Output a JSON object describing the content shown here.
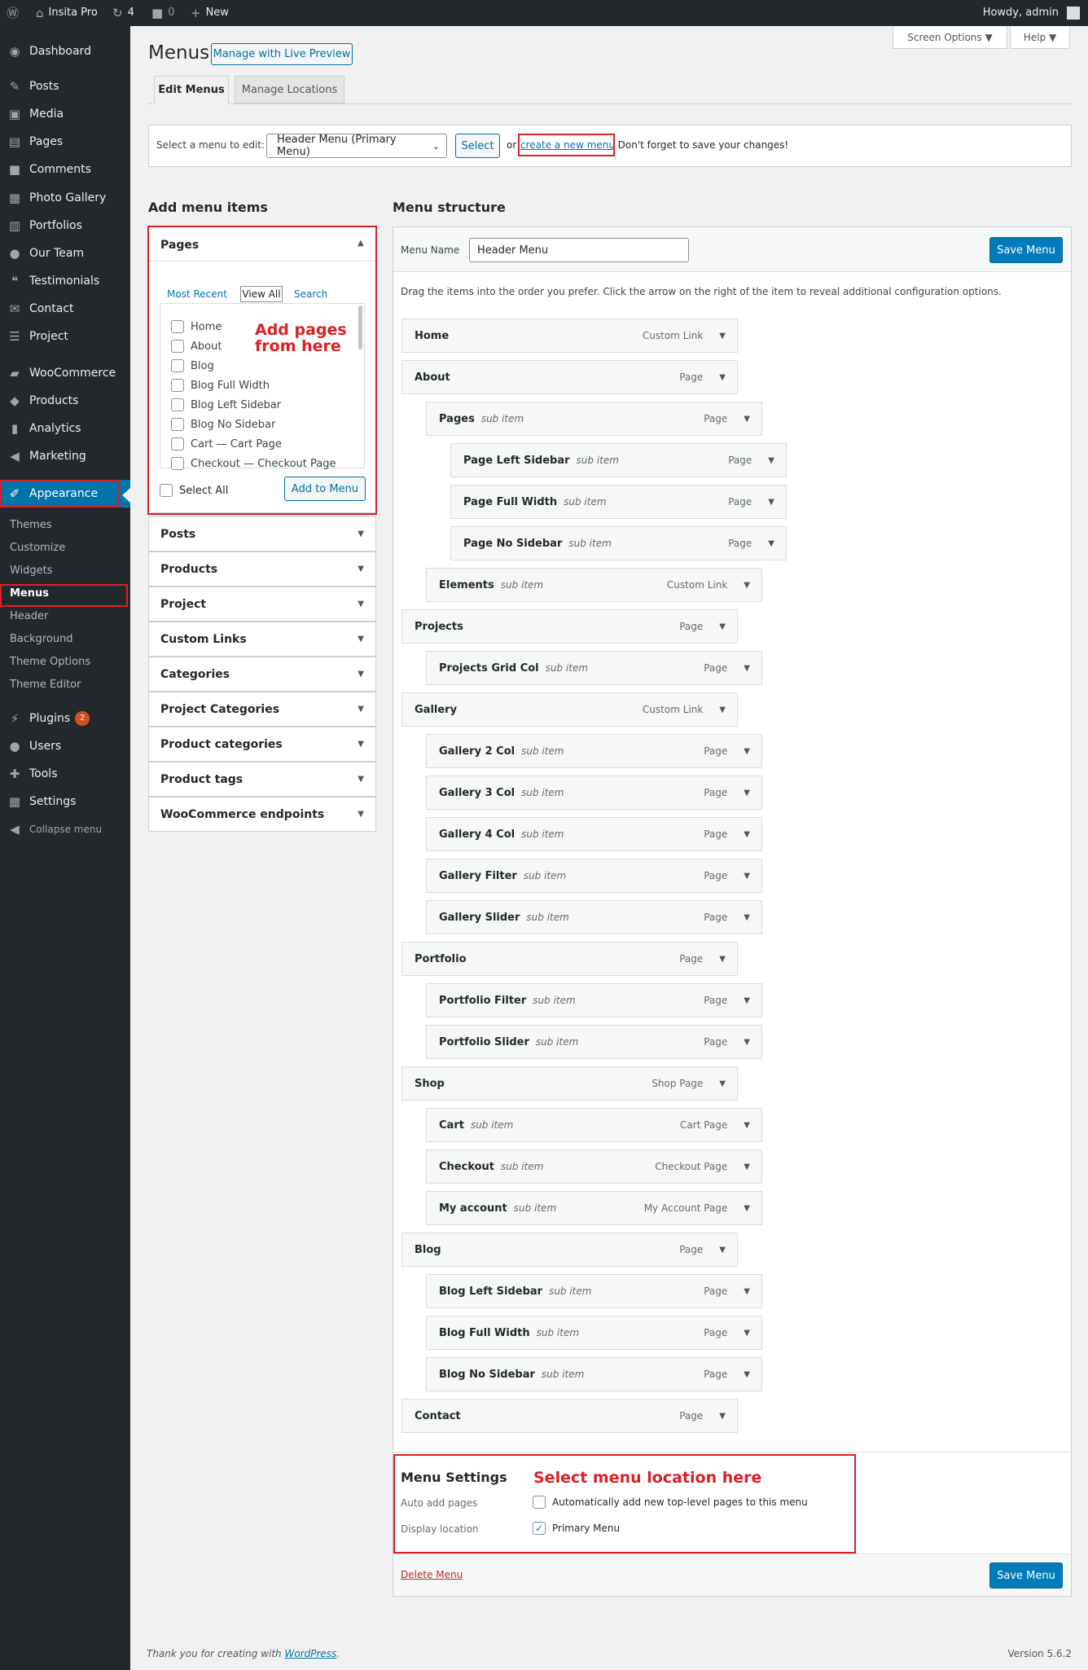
{
  "adminbar": {
    "site": "Insita Pro",
    "updates": "4",
    "comments": "0",
    "new": "New",
    "howdy": "Howdy, admin"
  },
  "sidebar": {
    "items": [
      {
        "label": "Dashboard",
        "icon": "dashboard-icon",
        "glyph": "◉"
      },
      {
        "label": "Posts",
        "icon": "pin-icon",
        "glyph": "✎"
      },
      {
        "label": "Media",
        "icon": "media-icon",
        "glyph": "▣"
      },
      {
        "label": "Pages",
        "icon": "pages-icon",
        "glyph": "▤"
      },
      {
        "label": "Comments",
        "icon": "comments-icon",
        "glyph": "■"
      },
      {
        "label": "Photo Gallery",
        "icon": "gallery-icon",
        "glyph": "▦"
      },
      {
        "label": "Portfolios",
        "icon": "portfolio-icon",
        "glyph": "▥"
      },
      {
        "label": "Our Team",
        "icon": "team-icon",
        "glyph": "●"
      },
      {
        "label": "Testimonials",
        "icon": "quote-icon",
        "glyph": "❝"
      },
      {
        "label": "Contact",
        "icon": "mail-icon",
        "glyph": "✉"
      },
      {
        "label": "Project",
        "icon": "project-icon",
        "glyph": "☰"
      },
      {
        "label": "WooCommerce",
        "icon": "woo-icon",
        "glyph": "▰"
      },
      {
        "label": "Products",
        "icon": "products-icon",
        "glyph": "◆"
      },
      {
        "label": "Analytics",
        "icon": "analytics-icon",
        "glyph": "▮"
      },
      {
        "label": "Marketing",
        "icon": "megaphone-icon",
        "glyph": "◀"
      },
      {
        "label": "Appearance",
        "icon": "brush-icon",
        "glyph": "✐"
      }
    ],
    "subs": [
      "Themes",
      "Customize",
      "Widgets",
      "Menus",
      "Header",
      "Background",
      "Theme Options",
      "Theme Editor"
    ],
    "items2": [
      {
        "label": "Plugins",
        "icon": "plugins-icon",
        "glyph": "⚡",
        "badge": "2"
      },
      {
        "label": "Users",
        "icon": "users-icon",
        "glyph": "●"
      },
      {
        "label": "Tools",
        "icon": "tools-icon",
        "glyph": "✚"
      },
      {
        "label": "Settings",
        "icon": "settings-icon",
        "glyph": "▦"
      },
      {
        "label": "Collapse menu",
        "icon": "collapse-icon",
        "glyph": "◀"
      }
    ]
  },
  "header": {
    "title": "Menus",
    "live_preview": "Manage with Live Preview",
    "screen_options": "Screen Options ▼",
    "help": "Help ▼"
  },
  "tabs": {
    "edit": "Edit Menus",
    "locations": "Manage Locations"
  },
  "select_bar": {
    "label": "Select a menu to edit:",
    "value": "Header Menu (Primary Menu)",
    "select_btn": "Select",
    "or": "or",
    "create_link": "create a new menu",
    "reminder": ". Don't forget to save your changes!"
  },
  "add_items": {
    "heading": "Add menu items",
    "pages_title": "Pages",
    "tab_recent": "Most Recent",
    "tab_all": "View All",
    "tab_search": "Search",
    "pages": [
      "Home",
      "About",
      "Blog",
      "Blog Full Width",
      "Blog Left Sidebar",
      "Blog No Sidebar",
      "Cart — Cart Page",
      "Checkout — Checkout Page"
    ],
    "annotation": "Add pages\nfrom here",
    "select_all": "Select All",
    "add_btn": "Add to Menu",
    "sections": [
      "Posts",
      "Products",
      "Project",
      "Custom Links",
      "Categories",
      "Project Categories",
      "Product categories",
      "Product tags",
      "WooCommerce endpoints"
    ]
  },
  "structure": {
    "heading": "Menu structure",
    "name_label": "Menu Name",
    "name_value": "Header Menu",
    "save": "Save Menu",
    "hint": "Drag the items into the order you prefer. Click the arrow on the right of the item to reveal additional configuration options.",
    "items": [
      {
        "title": "Home",
        "sub": "",
        "type": "Custom Link",
        "depth": 0
      },
      {
        "title": "About",
        "sub": "",
        "type": "Page",
        "depth": 0
      },
      {
        "title": "Pages",
        "sub": "sub item",
        "type": "Page",
        "depth": 1
      },
      {
        "title": "Page Left Sidebar",
        "sub": "sub item",
        "type": "Page",
        "depth": 2
      },
      {
        "title": "Page Full Width",
        "sub": "sub item",
        "type": "Page",
        "depth": 2
      },
      {
        "title": "Page No Sidebar",
        "sub": "sub item",
        "type": "Page",
        "depth": 2
      },
      {
        "title": "Elements",
        "sub": "sub item",
        "type": "Custom Link",
        "depth": 1
      },
      {
        "title": "Projects",
        "sub": "",
        "type": "Page",
        "depth": 0
      },
      {
        "title": "Projects Grid Col",
        "sub": "sub item",
        "type": "Page",
        "depth": 1
      },
      {
        "title": "Gallery",
        "sub": "",
        "type": "Custom Link",
        "depth": 0
      },
      {
        "title": "Gallery 2 Col",
        "sub": "sub item",
        "type": "Page",
        "depth": 1
      },
      {
        "title": "Gallery 3 Col",
        "sub": "sub item",
        "type": "Page",
        "depth": 1
      },
      {
        "title": "Gallery 4 Col",
        "sub": "sub item",
        "type": "Page",
        "depth": 1
      },
      {
        "title": "Gallery Filter",
        "sub": "sub item",
        "type": "Page",
        "depth": 1
      },
      {
        "title": "Gallery Slider",
        "sub": "sub item",
        "type": "Page",
        "depth": 1
      },
      {
        "title": "Portfolio",
        "sub": "",
        "type": "Page",
        "depth": 0
      },
      {
        "title": "Portfolio Filter",
        "sub": "sub item",
        "type": "Page",
        "depth": 1
      },
      {
        "title": "Portfolio Slider",
        "sub": "sub item",
        "type": "Page",
        "depth": 1
      },
      {
        "title": "Shop",
        "sub": "",
        "type": "Shop Page",
        "depth": 0
      },
      {
        "title": "Cart",
        "sub": "sub item",
        "type": "Cart Page",
        "depth": 1
      },
      {
        "title": "Checkout",
        "sub": "sub item",
        "type": "Checkout Page",
        "depth": 1
      },
      {
        "title": "My account",
        "sub": "sub item",
        "type": "My Account Page",
        "depth": 1
      },
      {
        "title": "Blog",
        "sub": "",
        "type": "Page",
        "depth": 0
      },
      {
        "title": "Blog Left Sidebar",
        "sub": "sub item",
        "type": "Page",
        "depth": 1
      },
      {
        "title": "Blog Full Width",
        "sub": "sub item",
        "type": "Page",
        "depth": 1
      },
      {
        "title": "Blog No Sidebar",
        "sub": "sub item",
        "type": "Page",
        "depth": 1
      },
      {
        "title": "Contact",
        "sub": "",
        "type": "Page",
        "depth": 0
      }
    ]
  },
  "settings": {
    "title": "Menu Settings",
    "annotation": "Select menu location here",
    "auto_label": "Auto add pages",
    "auto_text": "Automatically add new top-level pages to this menu",
    "loc_label": "Display location",
    "loc_text": "Primary Menu",
    "delete": "Delete Menu",
    "save": "Save Menu"
  },
  "footer": {
    "thanks": "Thank you for creating with ",
    "wp": "WordPress",
    "dot": ".",
    "version": "Version 5.6.2"
  },
  "colors": {
    "accent": "#0073aa",
    "annotation": "#dd1f26",
    "sidebar": "#23282d"
  }
}
